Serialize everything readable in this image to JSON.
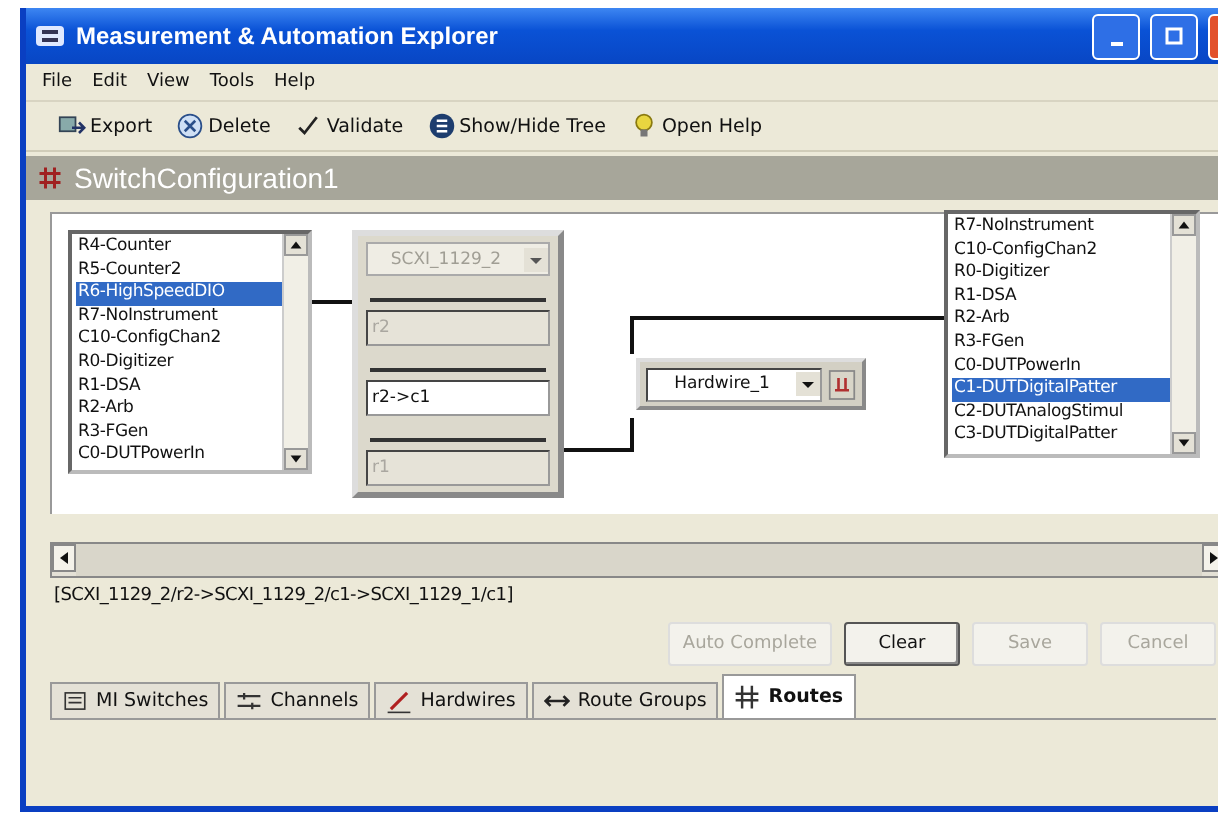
{
  "window": {
    "title": "Measurement & Automation Explorer"
  },
  "menu": [
    "File",
    "Edit",
    "View",
    "Tools",
    "Help"
  ],
  "toolbar": [
    {
      "label": "Export",
      "kind": "export"
    },
    {
      "label": "Delete",
      "kind": "delete"
    },
    {
      "label": "Validate",
      "kind": "check"
    },
    {
      "label": "Show/Hide Tree",
      "kind": "tree"
    },
    {
      "label": "Open Help",
      "kind": "help"
    }
  ],
  "header": {
    "title": "SwitchConfiguration1"
  },
  "left_list": [
    {
      "label": "R4-Counter",
      "selected": false
    },
    {
      "label": "R5-Counter2",
      "selected": false
    },
    {
      "label": "R6-HighSpeedDIO",
      "selected": true
    },
    {
      "label": "R7-NoInstrument",
      "selected": false
    },
    {
      "label": "C10-ConfigChan2",
      "selected": false
    },
    {
      "label": "R0-Digitizer",
      "selected": false
    },
    {
      "label": "R1-DSA",
      "selected": false
    },
    {
      "label": "R2-Arb",
      "selected": false
    },
    {
      "label": "R3-FGen",
      "selected": false
    },
    {
      "label": "C0-DUTPowerIn",
      "selected": false
    }
  ],
  "switch_panel": {
    "device": {
      "value": "SCXI_1129_2",
      "disabled": true
    },
    "fields": [
      {
        "value": "r2",
        "disabled": true
      },
      {
        "value": "r2->c1",
        "disabled": false
      },
      {
        "value": "r1",
        "disabled": true
      }
    ]
  },
  "hardwire": {
    "value": "Hardwire_1"
  },
  "right_list": [
    {
      "label": "R7-NoInstrument",
      "selected": false
    },
    {
      "label": "C10-ConfigChan2",
      "selected": false
    },
    {
      "label": "R0-Digitizer",
      "selected": false
    },
    {
      "label": "R1-DSA",
      "selected": false
    },
    {
      "label": "R2-Arb",
      "selected": false
    },
    {
      "label": "R3-FGen",
      "selected": false
    },
    {
      "label": "C0-DUTPowerIn",
      "selected": false
    },
    {
      "label": "C1-DUTDigitalPatter",
      "selected": true
    },
    {
      "label": "C2-DUTAnalogStimul",
      "selected": false
    },
    {
      "label": "C3-DUTDigitalPatter",
      "selected": false
    }
  ],
  "route_path": "[SCXI_1129_2/r2->SCXI_1129_2/c1->SCXI_1129_1/c1]",
  "buttons": [
    {
      "label": "Auto Complete",
      "disabled": true
    },
    {
      "label": "Clear",
      "disabled": false
    },
    {
      "label": "Save",
      "disabled": true
    },
    {
      "label": "Cancel",
      "disabled": true
    }
  ],
  "tabs": [
    {
      "label": "MI Switches",
      "kind": "switch",
      "selected": false
    },
    {
      "label": "Channels",
      "kind": "channels",
      "selected": false
    },
    {
      "label": "Hardwires",
      "kind": "pen",
      "selected": false
    },
    {
      "label": "Route Groups",
      "kind": "group",
      "selected": false
    },
    {
      "label": "Routes",
      "kind": "routes",
      "selected": true
    }
  ]
}
